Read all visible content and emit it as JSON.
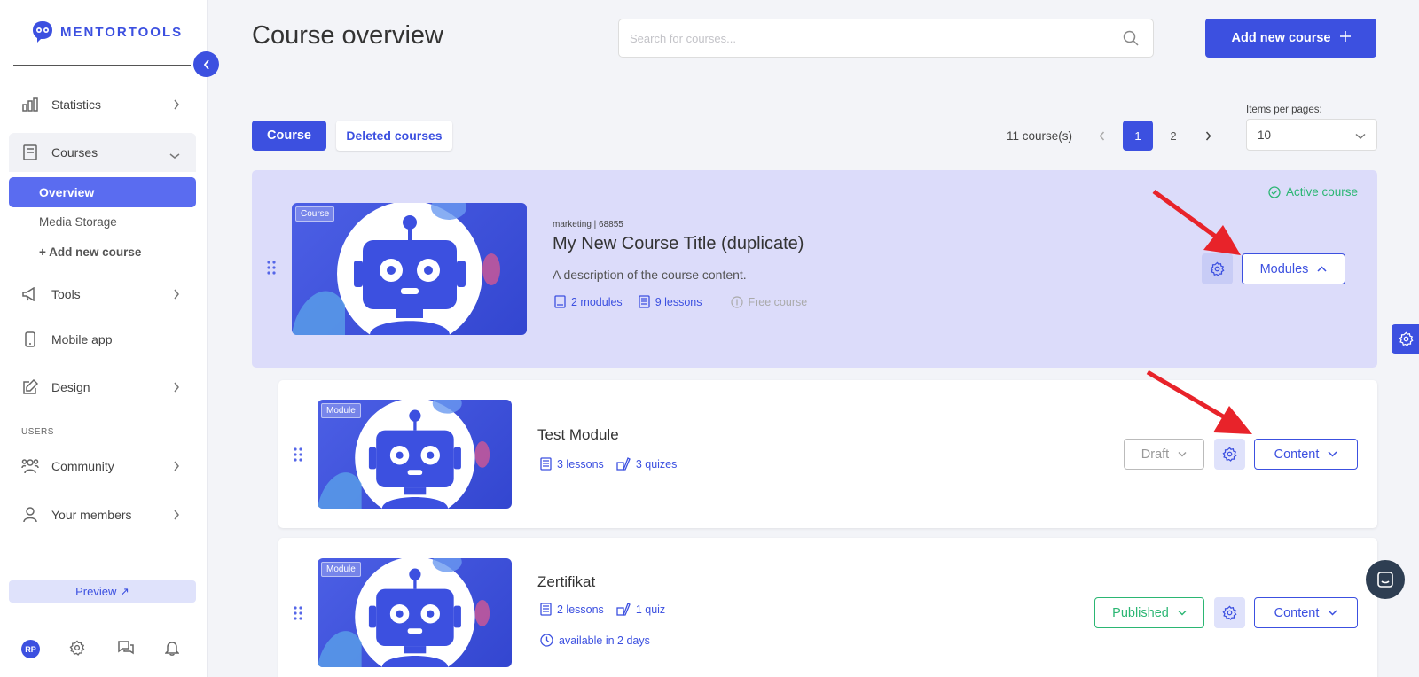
{
  "brand": {
    "name": "MENTORTOOLS"
  },
  "sidebar": {
    "items": [
      {
        "label": "Statistics"
      },
      {
        "label": "Courses"
      },
      {
        "label": "Tools"
      },
      {
        "label": "Mobile app"
      },
      {
        "label": "Design"
      },
      {
        "label": "Community"
      },
      {
        "label": "Your members"
      }
    ],
    "courses_sub": [
      "Overview",
      "Media Storage",
      "+ Add new course"
    ],
    "section_users": "USERS",
    "preview": "Preview ↗",
    "avatar_initials": "RP"
  },
  "header": {
    "title": "Course overview",
    "search_placeholder": "Search for courses...",
    "add_button": "Add new course"
  },
  "toolbar": {
    "tab_course": "Course",
    "tab_deleted": "Deleted courses",
    "count": "11 course(s)",
    "pages": [
      "1",
      "2"
    ],
    "items_per_page_label": "Items per pages:",
    "items_per_page": "10"
  },
  "course": {
    "badge": "Course",
    "meta": "marketing | 68855",
    "title": "My New Course Title (duplicate)",
    "description": "A description of the course content.",
    "modules": "2 modules",
    "lessons": "9 lessons",
    "price": "Free course",
    "status": "Active course",
    "modules_button": "Modules"
  },
  "modules": [
    {
      "badge": "Module",
      "title": "Test Module",
      "lessons": "3 lessons",
      "quizzes": "3 quizes",
      "status": "Draft",
      "content_button": "Content"
    },
    {
      "badge": "Module",
      "title": "Zertifikat",
      "lessons": "2 lessons",
      "quizzes": "1 quiz",
      "availability": "available in 2 days",
      "status": "Published",
      "content_button": "Content"
    }
  ],
  "colors": {
    "accent": "#3c50e0",
    "success": "#2bb673",
    "annotation": "#e8232a"
  }
}
